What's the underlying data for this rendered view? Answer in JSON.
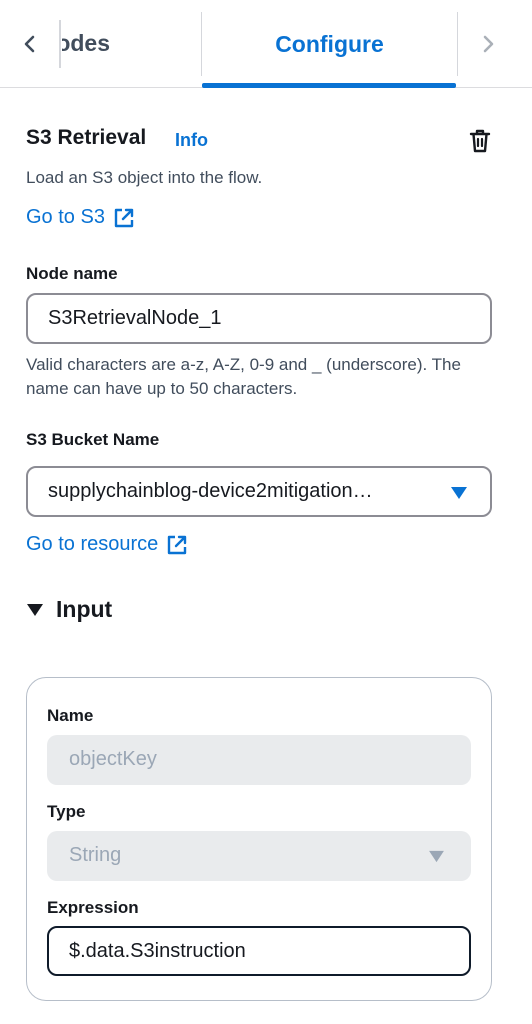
{
  "tabs": {
    "prev_tab_label": "Nodes",
    "active_tab_label": "Configure"
  },
  "panel": {
    "title": "S3 Retrieval",
    "info_label": "Info",
    "description": "Load an S3 object into the flow.",
    "go_to_s3_label": "Go to S3"
  },
  "node_name": {
    "label": "Node name",
    "value": "S3RetrievalNode_1",
    "hint": "Valid characters are a-z, A-Z, 0-9 and _ (underscore). The name can have up to 50 characters."
  },
  "bucket": {
    "label": "S3 Bucket Name",
    "selected": "supplychainblog-device2mitigation…",
    "go_to_resource_label": "Go to resource"
  },
  "input_section": {
    "title": "Input",
    "expanded": true,
    "name_label": "Name",
    "name_value": "objectKey",
    "type_label": "Type",
    "type_value": "String",
    "expression_label": "Expression",
    "expression_value": "$.data.S3instruction"
  },
  "colors": {
    "accent": "#0972d3",
    "text": "#16191f",
    "muted": "#414d5c",
    "disabled_bg": "#e9ebed"
  },
  "icons": {
    "back": "chevron-left-icon",
    "forward": "chevron-right-icon",
    "delete": "trash-icon",
    "external": "external-link-icon",
    "caret": "caret-down-icon"
  }
}
